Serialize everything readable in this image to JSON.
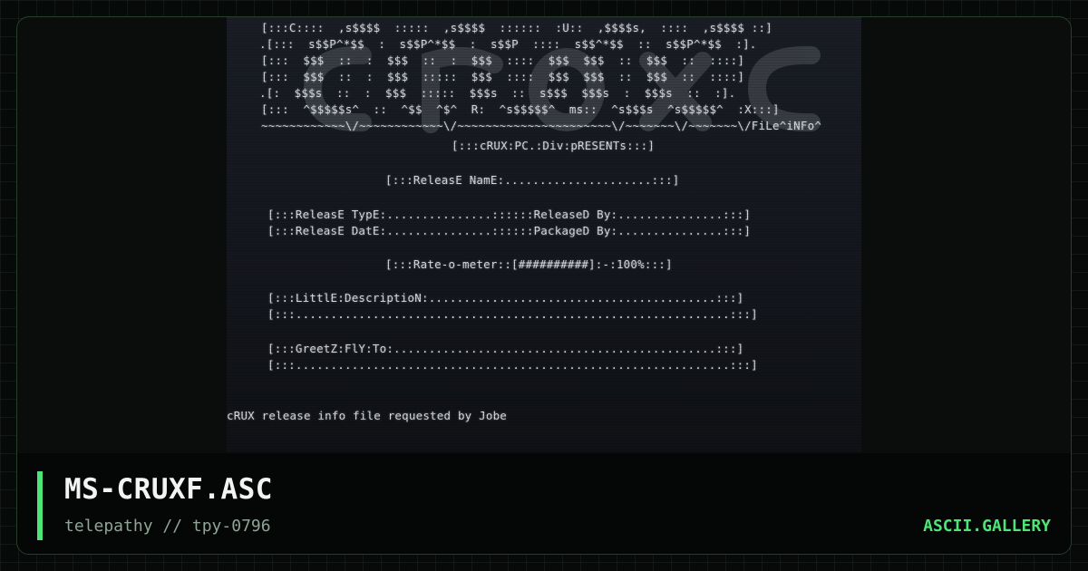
{
  "art": {
    "logo_lines": [
      "[:::C::::  ,s$$$$  :::::  ,s$$$$  ::::::  :U::  ,$$$$s,  ::::  ,s$$$$ ::]",
      ".[:::  s$$P^*$$  :  s$$P^*$$  :  s$$P  ::::  s$$^*$$  ::  s$$P^*$$  :].",
      "[:::  $$$  ::  :  $$$  ::  :  $$$  ::::  $$$  $$$  ::  $$$  ::  ::::]",
      "[:::  $$$  ::  :  $$$  :::::  $$$  ::::  $$$  $$$  ::  $$$  ::  ::::]",
      ".[:  $$$s  ::  :  $$$  :::::  $$$s  ::  s$$$  $$$s  :  $$$s  ::  :].",
      "[:::  ^$$$$$s^  ::  ^$$  ^$^  R:  ^s$$$$$^  ms::  ^s$$$s  ^s$$$$$^  :X:::]"
    ],
    "logo_tag": "~~~~~~~~~~~~\\/~~~~~~~~~~~~\\/~~~~~~~~~~~~~~~~~~~~~~\\/~~~~~~~\\/~~~~~~~\\/FiLe^iNFo^",
    "presents": "[:::cRUX:PC.:Div:pRESENTs:::]",
    "release_name": "[:::ReleasE NamE:.....................:::]",
    "release_type": "[:::ReleasE TypE:...............::::::ReleaseD By:...............:::]",
    "release_date": "[:::ReleasE DatE:...............::::::PackageD By:...............:::]",
    "rate_o_meter": "[:::Rate-o-meter::[##########]:-:100%:::]",
    "description_1": "[:::LittlE:DescriptioN:.........................................:::]",
    "description_2": "[:::..............................................................:::]",
    "greetz_1": "[:::GreetZ:FlY:To:..............................................:::]",
    "greetz_2": "[:::..............................................................:::]",
    "request_note": "cRUX release info file requested by Jobe"
  },
  "footer": {
    "title": "MS-CRUXF.ASC",
    "subtitle": "telepathy // tpy-0796",
    "brand": "ASCII.GALLERY"
  },
  "colors": {
    "accent": "#4ee476",
    "background": "#080a0a",
    "ascii_text": "#d6d9de"
  }
}
